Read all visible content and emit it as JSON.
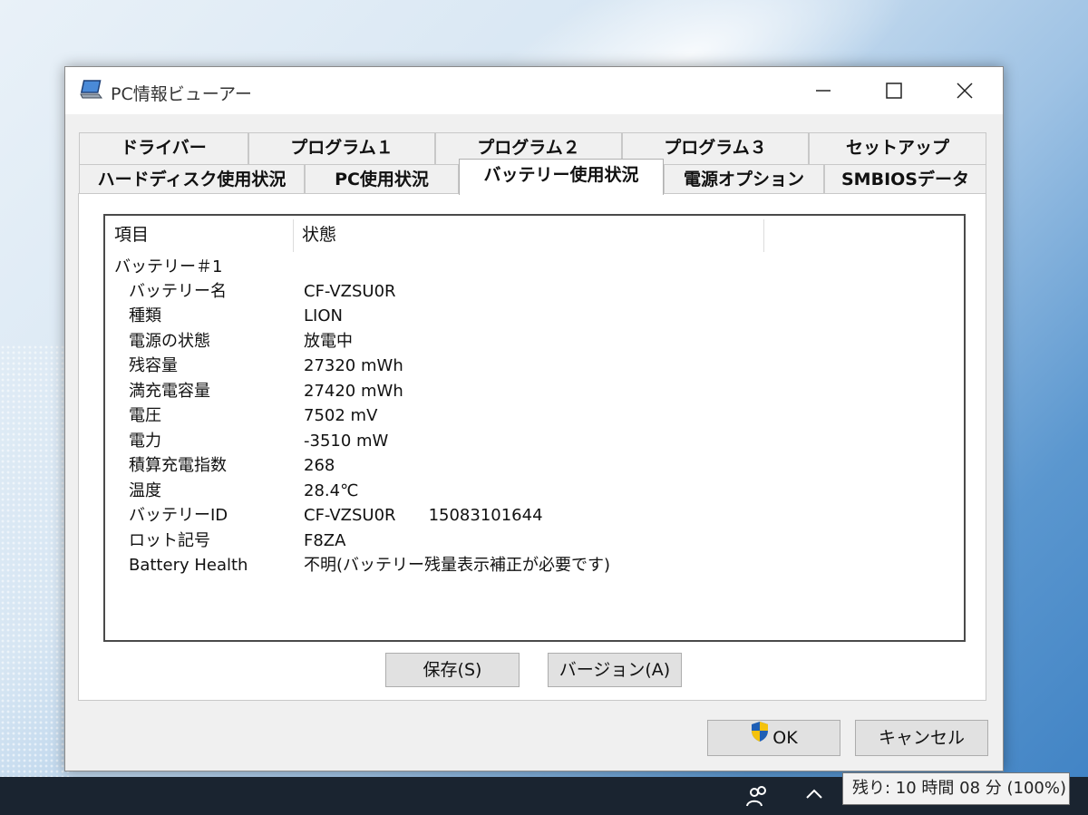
{
  "window": {
    "title": "PC情報ビューアー"
  },
  "tabs_row1": [
    {
      "label": "ドライバー"
    },
    {
      "label": "プログラム１"
    },
    {
      "label": "プログラム２"
    },
    {
      "label": "プログラム３"
    },
    {
      "label": "セットアップ"
    }
  ],
  "tabs_row2": [
    {
      "label": "ハードディスク使用状況"
    },
    {
      "label": "PC使用状況"
    },
    {
      "label": "バッテリー使用状況",
      "active": true
    },
    {
      "label": "電源オプション"
    },
    {
      "label": "SMBIOSデータ"
    }
  ],
  "list": {
    "col_item": "項目",
    "col_state": "状態",
    "group": "バッテリー＃1",
    "rows": [
      {
        "item": "バッテリー名",
        "value": "CF-VZSU0R"
      },
      {
        "item": "種類",
        "value": "LION"
      },
      {
        "item": "電源の状態",
        "value": "放電中"
      },
      {
        "item": "残容量",
        "value": "27320 mWh"
      },
      {
        "item": "満充電容量",
        "value": "27420 mWh"
      },
      {
        "item": "電圧",
        "value": "7502 mV"
      },
      {
        "item": "電力",
        "value": "-3510 mW"
      },
      {
        "item": "積算充電指数",
        "value": "268"
      },
      {
        "item": "温度",
        "value": "28.4℃"
      },
      {
        "item": "バッテリーID",
        "value": "CF-VZSU0R　　15083101644"
      },
      {
        "item": "ロット記号",
        "value": "F8ZA"
      },
      {
        "item": "Battery Health",
        "value": "不明(バッテリー残量表示補正が必要です)"
      }
    ]
  },
  "buttons": {
    "save": "保存(S)",
    "version": "バージョン(A)",
    "ok": "OK",
    "cancel": "キャンセル"
  },
  "tooltip": {
    "battery_remaining": "残り: 10 時間 08 分 (100%)"
  },
  "colors": {
    "ok_shield_blue": "#1e5fb5",
    "ok_shield_yellow": "#f4c20d"
  }
}
